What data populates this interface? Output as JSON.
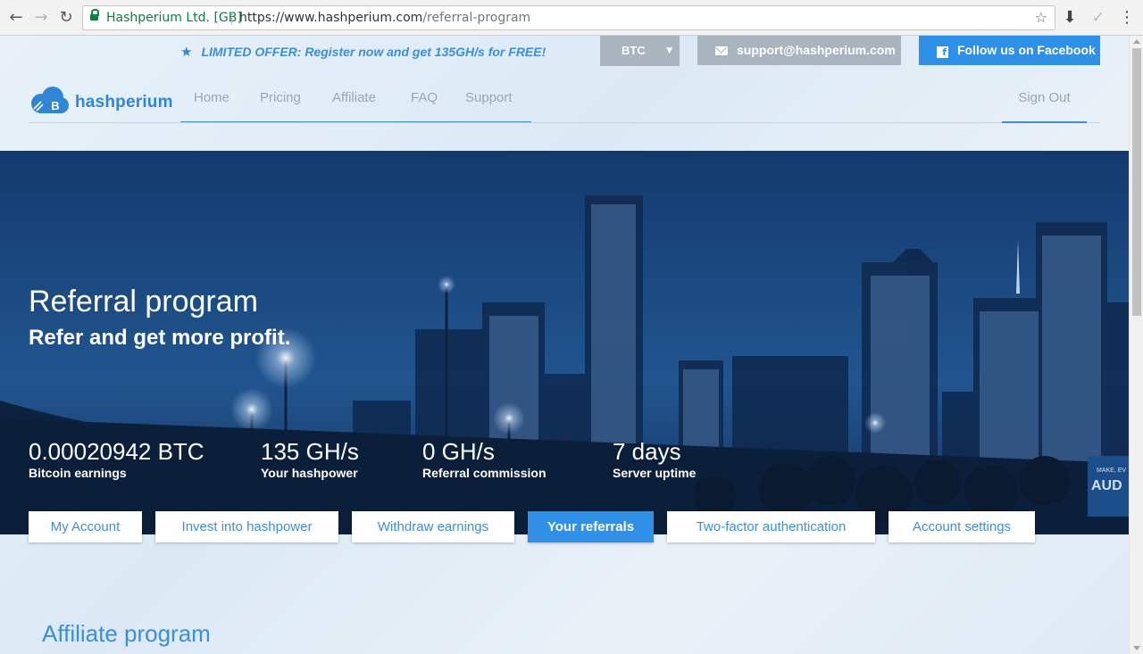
{
  "browser": {
    "site_name": "Hashperium Ltd. [GB]",
    "url_origin": "https://www.hashperium.com",
    "url_path": "/referral-program"
  },
  "topbar": {
    "offer_text": "LIMITED OFFER: Register now and get 135GH/s for FREE!",
    "currency": "BTC",
    "support_email": "support@hashperium.com",
    "facebook_label": "Follow us on Facebook"
  },
  "logo": {
    "name": "hashperium",
    "badge": "B"
  },
  "nav": {
    "items": [
      "Home",
      "Pricing",
      "Affiliate",
      "FAQ",
      "Support"
    ],
    "signout": "Sign Out"
  },
  "hero": {
    "title": "Referral program",
    "subtitle": "Refer and get more profit.",
    "billboard": "MAKE, EV... AUD",
    "stats": [
      {
        "value": "0.00020942 BTC",
        "label": "Bitcoin earnings"
      },
      {
        "value": "135 GH/s",
        "label": "Your hashpower"
      },
      {
        "value": "0 GH/s",
        "label": "Referral commission"
      },
      {
        "value": "7 days",
        "label": "Server uptime"
      }
    ]
  },
  "tabs": [
    {
      "label": "My Account",
      "active": false
    },
    {
      "label": "Invest into hashpower",
      "active": false
    },
    {
      "label": "Withdraw earnings",
      "active": false
    },
    {
      "label": "Your referrals",
      "active": true
    },
    {
      "label": "Two-factor authentication",
      "active": false
    },
    {
      "label": "Account settings",
      "active": false
    }
  ],
  "section": {
    "title": "Affiliate program"
  },
  "colors": {
    "accent": "#2f90e8",
    "nav_text": "#9aa6b1",
    "button_gray": "#a9b4bf",
    "secure_green": "#0b8043"
  }
}
